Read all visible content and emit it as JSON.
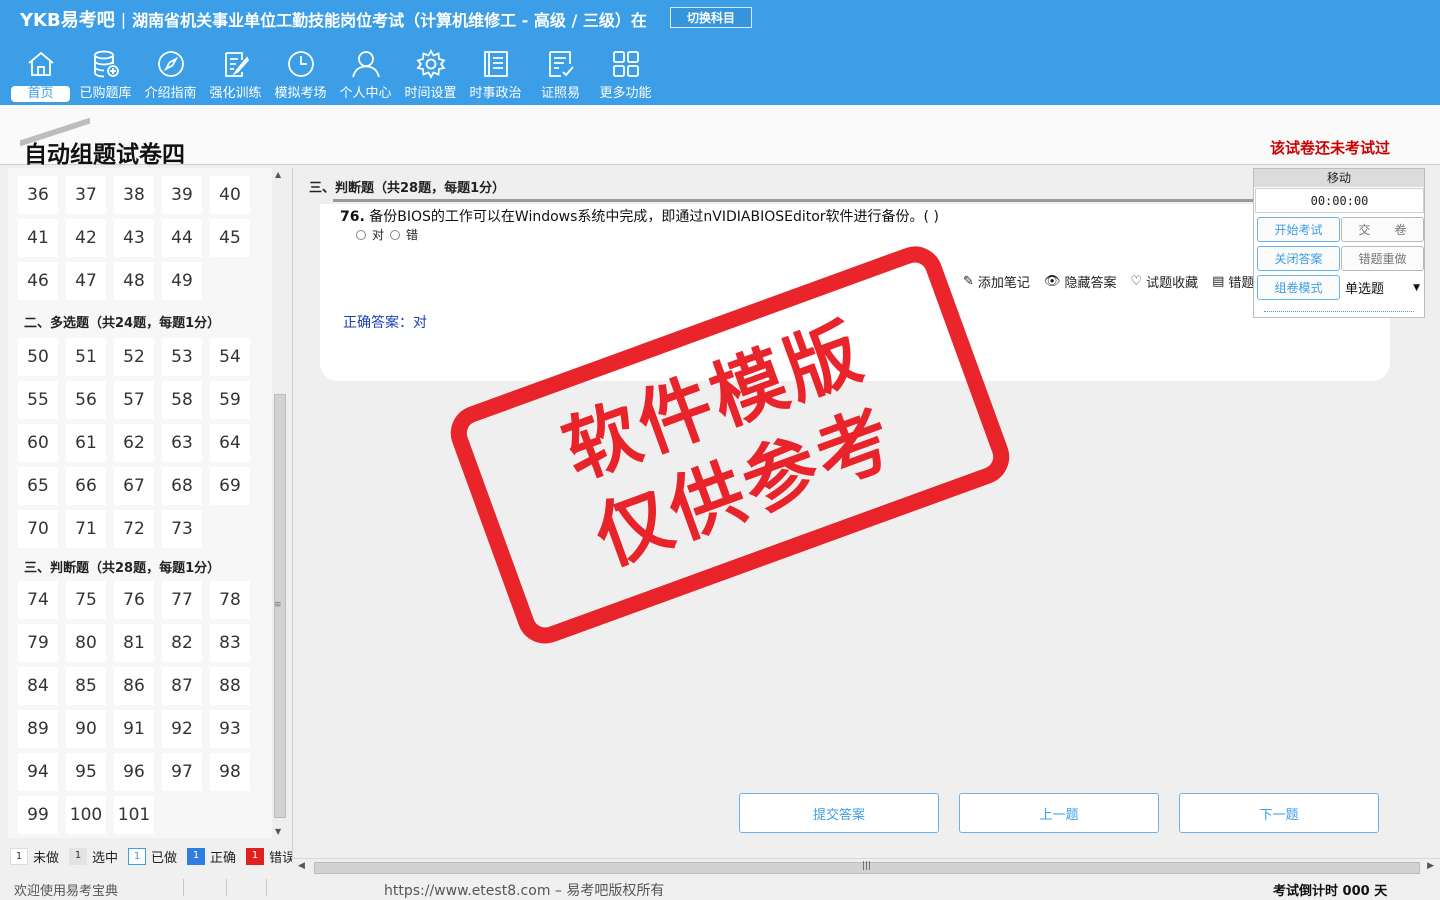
{
  "header": {
    "brand": "YKB易考吧",
    "separator": "|",
    "title": "湖南省机关事业单位工勤技能岗位考试（计算机维修工 - 高级 / 三级）在",
    "switch_subject": "切换科目",
    "nav": [
      {
        "label": "首页",
        "icon": "home-icon",
        "active": true
      },
      {
        "label": "已购题库",
        "icon": "database-add-icon"
      },
      {
        "label": "介绍指南",
        "icon": "compass-icon"
      },
      {
        "label": "强化训练",
        "icon": "edit-icon"
      },
      {
        "label": "模拟考场",
        "icon": "clock-icon"
      },
      {
        "label": "个人中心",
        "icon": "user-icon"
      },
      {
        "label": "时间设置",
        "icon": "gear-icon"
      },
      {
        "label": "时事政治",
        "icon": "notebook-icon"
      },
      {
        "label": "证照易",
        "icon": "certificate-icon"
      },
      {
        "label": "更多功能",
        "icon": "grid-icon"
      }
    ]
  },
  "paper": {
    "title": "自动组题试卷四",
    "status": "该试卷还未考试过"
  },
  "sidebar": {
    "group1": [
      "36",
      "37",
      "38",
      "39",
      "40",
      "41",
      "42",
      "43",
      "44",
      "45",
      "46",
      "47",
      "48",
      "49"
    ],
    "section2": "二、多选题（共24题，每题1分）",
    "group2": [
      "50",
      "51",
      "52",
      "53",
      "54",
      "55",
      "56",
      "57",
      "58",
      "59",
      "60",
      "61",
      "62",
      "63",
      "64",
      "65",
      "66",
      "67",
      "68",
      "69",
      "70",
      "71",
      "72",
      "73"
    ],
    "section3": "三、判断题（共28题，每题1分）",
    "group3": [
      "74",
      "75",
      "76",
      "77",
      "78",
      "79",
      "80",
      "81",
      "82",
      "83",
      "84",
      "85",
      "86",
      "87",
      "88",
      "89",
      "90",
      "91",
      "92",
      "93",
      "94",
      "95",
      "96",
      "97",
      "98",
      "99",
      "100",
      "101"
    ]
  },
  "legend": {
    "sample": "1",
    "undone": "未做",
    "selected": "选中",
    "done": "已做",
    "correct": "正确",
    "wrong": "错误"
  },
  "question": {
    "section": "三、判断题（共28题，每题1分）",
    "number": "76.",
    "text": "备份BIOS的工作可以在Windows系统中完成，即通过nVIDIABIOSEditor软件进行备份。( )",
    "option_a": "对",
    "option_b": "错",
    "tools": {
      "add_note": "添加笔记",
      "hide_answer": "隐藏答案",
      "favorite": "试题收藏",
      "wrong_set": "错题"
    },
    "answer_label": "正确答案：",
    "answer_value": "对"
  },
  "buttons": {
    "submit": "提交答案",
    "prev": "上一题",
    "next": "下一题"
  },
  "control": {
    "move": "移动",
    "timer": "00:00:00",
    "start_exam": "开始考试",
    "hand_in": "交　　卷",
    "close_answer": "关闭答案",
    "redo_wrong": "错题重做",
    "compose_mode": "组卷模式",
    "question_type": "单选题"
  },
  "watermark": {
    "line1": "软件模版",
    "line2": "仅供参考"
  },
  "status": {
    "welcome": "欢迎使用易考宝典",
    "copyright": "https://www.etest8.com – 易考吧版权所有",
    "countdown": "考试倒计时 000 天"
  },
  "colors": {
    "primary": "#3b9ee6",
    "status_red": "#cc0000",
    "answer_blue": "#1c3fb0",
    "stamp_red": "#e8141c"
  }
}
